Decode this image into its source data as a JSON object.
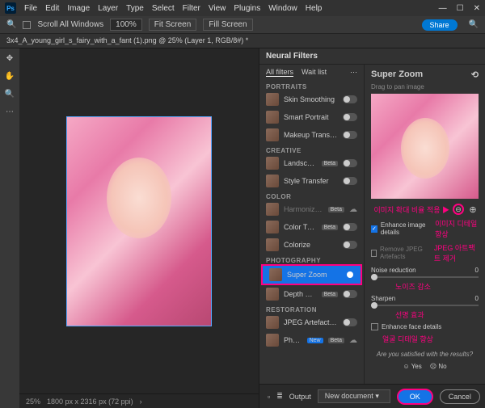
{
  "app": {
    "logo": "Ps"
  },
  "menus": [
    "File",
    "Edit",
    "Image",
    "Layer",
    "Type",
    "Select",
    "Filter",
    "View",
    "Plugins",
    "Window",
    "Help"
  ],
  "options": {
    "scroll_all": "Scroll All Windows",
    "zoom": "100%",
    "fit": "Fit Screen",
    "fill": "Fill Screen",
    "share": "Share"
  },
  "tab": {
    "title": "3x4_A_young_girl_s_fairy_with_a_fant (1).png @ 25% (Layer 1, RGB/8#) *"
  },
  "status": {
    "zoom": "25%",
    "dims": "1800 px x 2316 px (72 ppi)"
  },
  "neural": {
    "title": "Neural Filters",
    "tabs": {
      "all": "All filters",
      "wait": "Wait list"
    },
    "groups": {
      "portraits": "PORTRAITS",
      "creative": "CREATIVE",
      "color": "COLOR",
      "photography": "PHOTOGRAPHY",
      "restoration": "RESTORATION"
    },
    "filters": {
      "skin": "Skin Smoothing",
      "smart": "Smart Portrait",
      "makeup": "Makeup Transfer",
      "landscape": "Landscape...",
      "style": "Style Transfer",
      "harmonize": "Harmoniza...",
      "colortrans": "Color Trans...",
      "colorize": "Colorize",
      "superzoom": "Super Zoom",
      "depthblur": "Depth Blur",
      "jpeg": "JPEG Artefacts Re...",
      "photo": "Pho..."
    },
    "beta": "Beta",
    "new": "New"
  },
  "detail": {
    "title": "Super Zoom",
    "drag": "Drag to pan image",
    "enhance_image": "Enhance image details",
    "remove_jpeg": "Remove JPEG Artefacts",
    "noise": "Noise reduction",
    "noise_val": "0",
    "sharpen": "Sharpen",
    "sharpen_val": "0",
    "enhance_face": "Enhance face details",
    "satisfied": "Are you satisfied with the results?",
    "yes": "Yes",
    "no": "No"
  },
  "annotations": {
    "zoom_ratio": "이미지 확대 비율 적용 ▶",
    "img_detail": "이미지 디테일 향상",
    "jpeg_remove": "JPEG 아트팩트 제거",
    "noise": "노이즈 감소",
    "sharpen": "선명 효과",
    "face": "얼굴 디테일 향상"
  },
  "footer": {
    "output": "Output",
    "target": "New document",
    "ok": "OK",
    "cancel": "Cancel"
  }
}
